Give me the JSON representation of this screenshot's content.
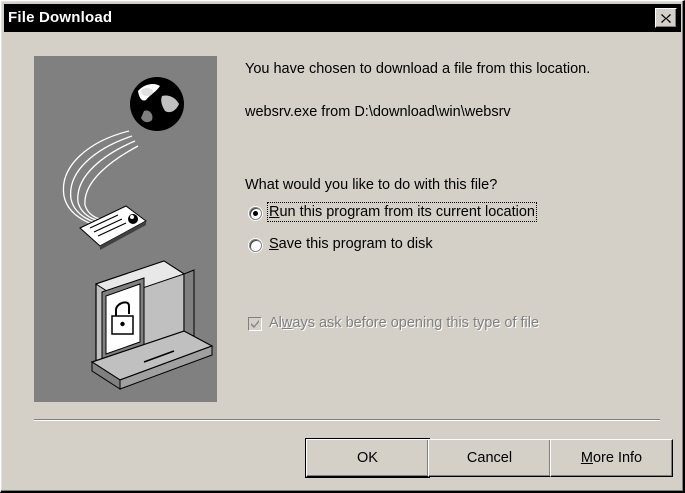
{
  "window": {
    "title": "File Download",
    "close_label": "Close"
  },
  "message": {
    "line1": "You have chosen to download a file from this location.",
    "location": "websrv.exe from D:\\download\\win\\websrv",
    "question": "What would you like to do with this file?"
  },
  "options": {
    "run": {
      "label_pre": "",
      "mnemonic": "R",
      "label_post": "un this program from its current location",
      "selected": true
    },
    "save": {
      "label_pre": "",
      "mnemonic": "S",
      "label_post": "ave this program to disk",
      "selected": false
    }
  },
  "always_ask": {
    "label_pre": "Al",
    "mnemonic": "w",
    "label_post": "ays ask before opening this type of file",
    "checked": true,
    "enabled": false
  },
  "buttons": {
    "ok": "OK",
    "cancel": "Cancel",
    "more_pre": "",
    "more_mnemonic": "M",
    "more_post": "ore Info"
  },
  "icons": {
    "close": "close-icon",
    "globe": "globe-icon",
    "document": "document-icon",
    "computer": "computer-icon",
    "lock": "lock-icon"
  }
}
